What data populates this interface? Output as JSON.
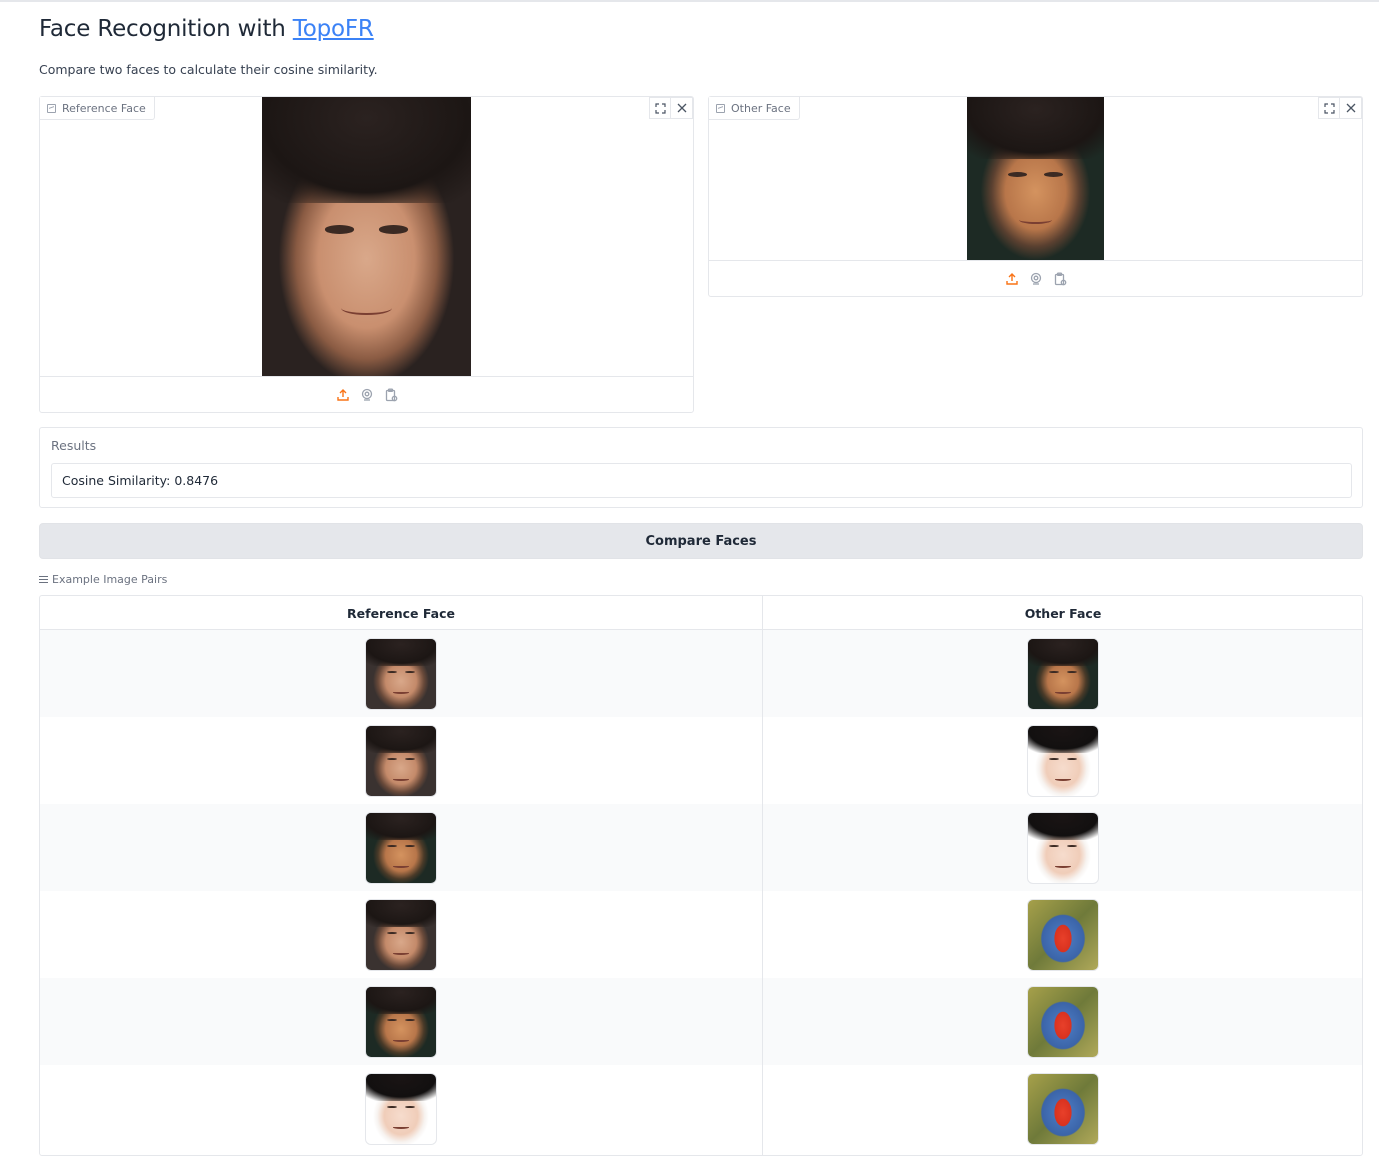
{
  "header": {
    "title_prefix": "Face Recognition with",
    "title_link": "TopoFR",
    "subtitle": "Compare two faces to calculate their cosine similarity."
  },
  "reference_input": {
    "label": "Reference Face",
    "icons": [
      "image-icon",
      "fullscreen-icon",
      "close-icon",
      "upload-icon",
      "webcam-icon",
      "clipboard-icon"
    ]
  },
  "other_input": {
    "label": "Other Face",
    "icons": [
      "image-icon",
      "fullscreen-icon",
      "close-icon",
      "upload-icon",
      "webcam-icon",
      "clipboard-icon"
    ]
  },
  "results": {
    "label": "Results",
    "value": "Cosine Similarity: 0.8476"
  },
  "actions": {
    "compare_label": "Compare Faces"
  },
  "examples": {
    "label": "Example Image Pairs",
    "columns": [
      "Reference Face",
      "Other Face"
    ],
    "rows": [
      {
        "reference": "person-a",
        "other": "person-a-outdoor"
      },
      {
        "reference": "person-a",
        "other": "person-b"
      },
      {
        "reference": "person-a-outdoor",
        "other": "person-b"
      },
      {
        "reference": "person-a",
        "other": "mandrill"
      },
      {
        "reference": "person-a-outdoor",
        "other": "mandrill"
      },
      {
        "reference": "person-b",
        "other": "mandrill"
      }
    ]
  },
  "colors": {
    "accent_orange": "#f97316",
    "link_blue": "#3b82f6",
    "border": "#e5e7eb",
    "button_bg": "#e5e7eb"
  }
}
